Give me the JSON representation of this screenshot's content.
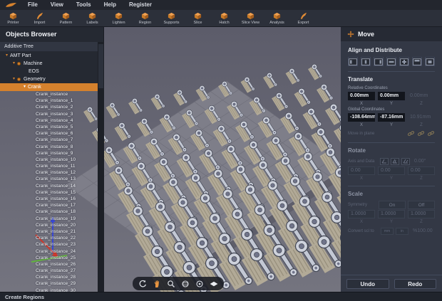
{
  "menu_bar": {
    "items": [
      "File",
      "View",
      "Tools",
      "Help",
      "Register"
    ]
  },
  "toolbar": {
    "items": [
      {
        "label": "Printer",
        "icon": "cube"
      },
      {
        "label": "Import",
        "icon": "swoosh"
      },
      {
        "label": "Pattern",
        "icon": "cube"
      },
      {
        "label": "Labels",
        "icon": "cube"
      },
      {
        "label": "Lighten",
        "icon": "cube"
      },
      {
        "label": "Region",
        "icon": "cube"
      },
      {
        "label": "Supports",
        "icon": "cube"
      },
      {
        "label": "Slice",
        "icon": "cube"
      },
      {
        "label": "Hatch",
        "icon": "cube"
      },
      {
        "label": "Slice View",
        "icon": "cube"
      },
      {
        "label": "Analysis",
        "icon": "cube"
      },
      {
        "label": "Export",
        "icon": "swoosh"
      }
    ]
  },
  "objects_browser": {
    "title": "Objects Browser",
    "tree_header": "Additive Tree",
    "tree": [
      {
        "label": "AMT Part",
        "indent": 8,
        "arrow": true,
        "icon": null,
        "selected": false
      },
      {
        "label": "Machine",
        "indent": 18,
        "arrow": true,
        "icon": "machine",
        "selected": false
      },
      {
        "label": "EOS",
        "indent": 40,
        "arrow": false,
        "icon": null,
        "selected": false
      },
      {
        "label": "Geometry",
        "indent": 18,
        "arrow": true,
        "icon": "geometry",
        "selected": false
      },
      {
        "label": "Crank",
        "indent": 33,
        "arrow": true,
        "icon": null,
        "selected": true
      }
    ],
    "instances": [
      "Crank_instance",
      "Crank_instance_1",
      "Crank_instance_2",
      "Crank_instance_3",
      "Crank_instance_4",
      "Crank_instance_5",
      "Crank_instance_6",
      "Crank_instance_7",
      "Crank_instance_8",
      "Crank_instance_9",
      "Crank_instance_10",
      "Crank_instance_11",
      "Crank_instance_12",
      "Crank_instance_13",
      "Crank_instance_14",
      "Crank_instance_15",
      "Crank_instance_16",
      "Crank_instance_17",
      "Crank_instance_18",
      "Crank_instance_19",
      "Crank_instance_20",
      "Crank_instance_21",
      "Crank_instance_22",
      "Crank_instance_23",
      "Crank_instance_24",
      "Crank_instance_25",
      "Crank_instance_26",
      "Crank_instance_27",
      "Crank_instance_28",
      "Crank_instance_29",
      "Crank_instance_30"
    ]
  },
  "move_panel": {
    "title": "Move",
    "align_section": {
      "title": "Align and Distribute",
      "buttons": [
        "align-left",
        "align-center-horizontal",
        "align-right",
        "align-middle-vertical",
        "align-center-both",
        "align-top",
        "align-bottom"
      ]
    },
    "axis_labels": [
      "X",
      "Y",
      "Z"
    ],
    "translate": {
      "title": "Translate",
      "relative_label": "Relative Coordinates",
      "relative": {
        "x": "0.00mm",
        "y": "0.00mm",
        "z": "0.00mm"
      },
      "global_label": "Global Coordinates",
      "global": {
        "x": "-108.64mm",
        "y": "-87.16mm",
        "z": "10.91mm"
      },
      "move_in_plane_label": "Move in plane"
    },
    "rotate": {
      "title": "Rotate",
      "axis_label": "Axis and Data",
      "angle": "0.00°",
      "values": [
        "0.00",
        "0.00",
        "0.00"
      ]
    },
    "scale": {
      "title": "Scale",
      "symmetry_label": "Symmetry",
      "on_label": "On",
      "off_label": "Off",
      "values": [
        "1.0000",
        "1.0000",
        "1.0000"
      ],
      "convert_label": "Convert scl to",
      "unit_buttons": [
        "mm",
        "in"
      ],
      "convert_value": "%100.00"
    },
    "undo_label": "Undo",
    "redo_label": "Redo"
  },
  "viewport": {
    "nav_icons": [
      "rotate-view-icon",
      "pan-icon",
      "zoom-icon",
      "orbit-icon",
      "focus-icon",
      "fit-view-icon"
    ]
  },
  "status_bar": {
    "text": "Create Regions"
  },
  "colors": {
    "accent": "#d5812d",
    "selection": "#d5812d",
    "panel_bg": "#333845",
    "viewport_bg": "#6a6a78",
    "field_bg": "#12151c",
    "axis_x": "#cf3a2e",
    "axis_y": "#62b53e",
    "axis_z": "#3a49d8"
  }
}
